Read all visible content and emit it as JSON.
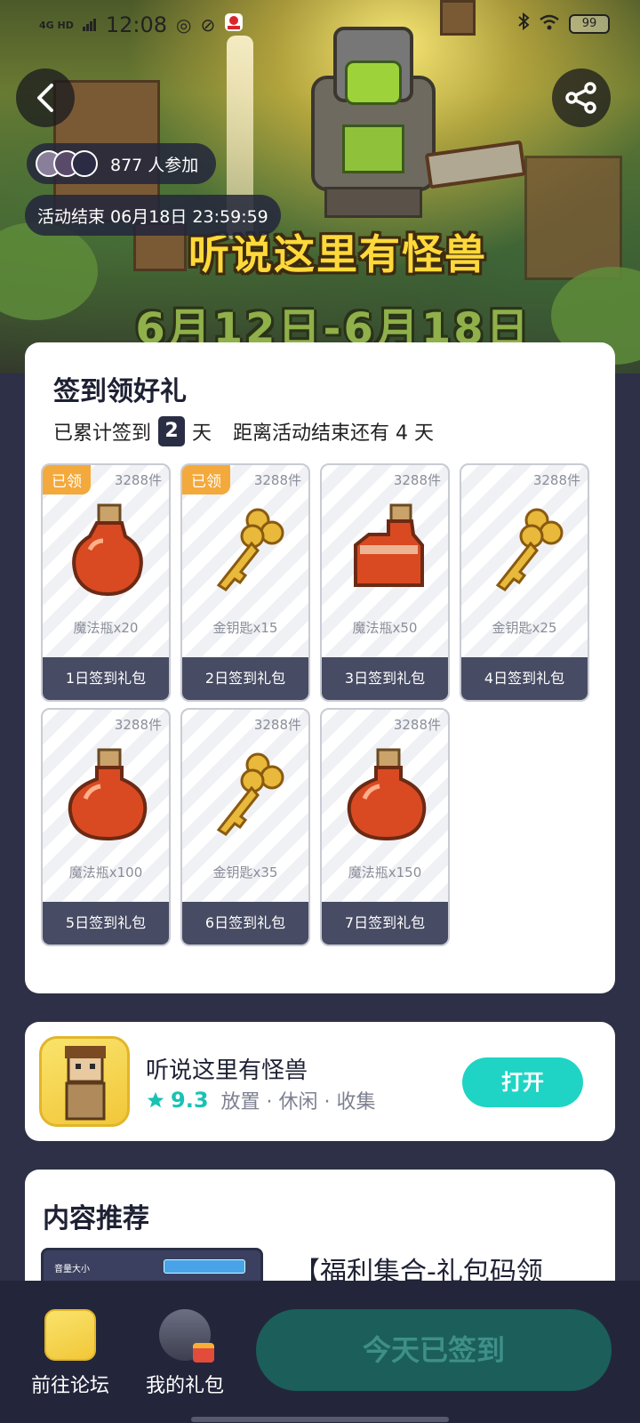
{
  "status_bar": {
    "network": "4G HD",
    "time": "12:08",
    "battery": "99",
    "icons": [
      "signal-icon",
      "bluetooth-icon",
      "wifi-icon",
      "battery-icon"
    ]
  },
  "banner": {
    "title": "听说这里有怪兽",
    "date_range": "6月12日-6月18日",
    "participants_text": "877 人参加",
    "deadline_text": "活动结束 06月18日 23:59:59"
  },
  "signin": {
    "title": "签到领好礼",
    "accumulated_prefix": "已累计签到",
    "days_signed": "2",
    "day_unit": "天",
    "remaining_text": "距离活动结束还有 4 天",
    "claimed_label": "已领",
    "gifts": [
      {
        "count": "3288件",
        "name": "魔法瓶x20",
        "label": "1日签到礼包",
        "item": "potion",
        "claimed": true
      },
      {
        "count": "3288件",
        "name": "金钥匙x15",
        "label": "2日签到礼包",
        "item": "key",
        "claimed": true
      },
      {
        "count": "3288件",
        "name": "魔法瓶x50",
        "label": "3日签到礼包",
        "item": "potion",
        "claimed": false
      },
      {
        "count": "3288件",
        "name": "金钥匙x25",
        "label": "4日签到礼包",
        "item": "key",
        "claimed": false
      },
      {
        "count": "3288件",
        "name": "魔法瓶x100",
        "label": "5日签到礼包",
        "item": "potion",
        "claimed": false
      },
      {
        "count": "3288件",
        "name": "金钥匙x35",
        "label": "6日签到礼包",
        "item": "key",
        "claimed": false
      },
      {
        "count": "3288件",
        "name": "魔法瓶x150",
        "label": "7日签到礼包",
        "item": "potion",
        "claimed": false
      }
    ]
  },
  "app": {
    "name": "听说这里有怪兽",
    "rating": "9.3",
    "tags": "放置 · 休闲 · 收集",
    "open_label": "打开"
  },
  "recommend": {
    "title": "内容推荐",
    "thumb_label": "音量大小",
    "first_item_title": "【福利集合-礼包码领"
  },
  "bottom": {
    "forum_label": "前往论坛",
    "gifts_label": "我的礼包",
    "signed_label": "今天已签到"
  },
  "colors": {
    "accent": "#1fd4c4",
    "claimed_tag": "#f3a93b",
    "card_footer": "#474b63",
    "page_bg": "#2d3046"
  }
}
